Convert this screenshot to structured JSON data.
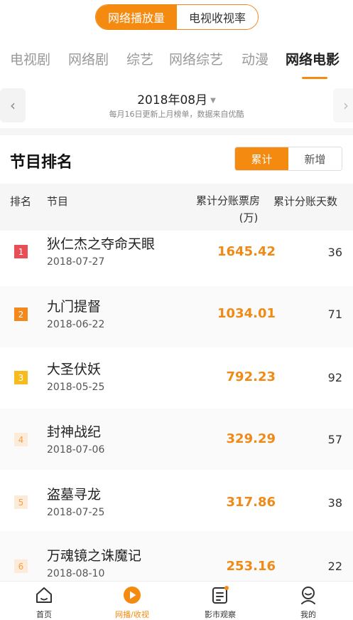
{
  "top_toggle": {
    "active": "网络播放量",
    "inactive": "电视收视率"
  },
  "categories": [
    {
      "label": "电视剧"
    },
    {
      "label": "网络剧"
    },
    {
      "label": "综艺"
    },
    {
      "label": "网络综艺"
    },
    {
      "label": "动漫"
    },
    {
      "label": "网络电影",
      "active": true
    }
  ],
  "month": {
    "title": "2018年08月",
    "subtitle": "每月16日更新上月榜单，数据来自优酷",
    "left_arrow": "‹",
    "right_arrow": "›",
    "caret": "▼"
  },
  "section": {
    "title": "节目排名",
    "toggle_active": "累计",
    "toggle_inactive": "新增"
  },
  "table": {
    "headers": {
      "rank": "排名",
      "program": "节目",
      "box_line1": "累计分账票房",
      "box_line2": "(万)",
      "days": "累计分账天数"
    },
    "rows": [
      {
        "rank": "1",
        "title": "狄仁杰之夺命天眼",
        "date": "2018-07-27",
        "box": "1645.42",
        "days": "36"
      },
      {
        "rank": "2",
        "title": "九门提督",
        "date": "2018-06-22",
        "box": "1034.01",
        "days": "71"
      },
      {
        "rank": "3",
        "title": "大圣伏妖",
        "date": "2018-05-25",
        "box": "792.23",
        "days": "92"
      },
      {
        "rank": "4",
        "title": "封神战纪",
        "date": "2018-07-06",
        "box": "329.29",
        "days": "57"
      },
      {
        "rank": "5",
        "title": "盗墓寻龙",
        "date": "2018-07-25",
        "box": "317.86",
        "days": "38"
      },
      {
        "rank": "6",
        "title": "万魂镜之诛魔记",
        "date": "2018-08-10",
        "box": "253.16",
        "days": "22"
      }
    ]
  },
  "tabbar": [
    {
      "label": "首页",
      "icon": "home-icon"
    },
    {
      "label": "网播/收视",
      "icon": "play-icon",
      "active": true
    },
    {
      "label": "影市观察",
      "icon": "report-icon"
    },
    {
      "label": "我的",
      "icon": "profile-icon"
    }
  ],
  "colors": {
    "accent": "#f58a11",
    "rank1": "#ea4e55",
    "rank2": "#f3891c",
    "rank3": "#f6bc1e"
  }
}
